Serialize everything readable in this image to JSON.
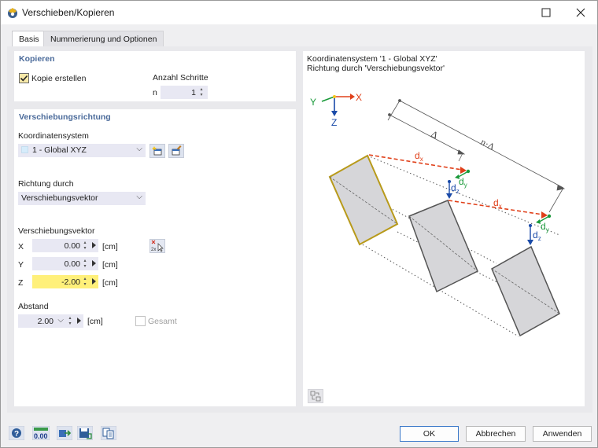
{
  "window": {
    "title": "Verschieben/Kopieren"
  },
  "tabs": [
    {
      "label": "Basis"
    },
    {
      "label": "Nummerierung und Optionen"
    }
  ],
  "kopieren": {
    "title": "Kopieren",
    "copy_label": "Kopie erstellen",
    "copy_checked": true,
    "steps_label": "Anzahl Schritte",
    "n_label": "n",
    "n_value": "1"
  },
  "verschiebung": {
    "title": "Verschiebungsrichtung",
    "coord_label": "Koordinatensystem",
    "coord_value": "1 - Global XYZ",
    "direction_label": "Richtung durch",
    "direction_value": "Verschiebungsvektor",
    "vector_label": "Verschiebungsvektor",
    "x_label": "X",
    "x_value": "0.00",
    "x_unit": "[cm]",
    "y_label": "Y",
    "y_value": "0.00",
    "y_unit": "[cm]",
    "z_label": "Z",
    "z_value": "-2.00",
    "z_unit": "[cm]",
    "distance_label": "Abstand",
    "distance_value": "2.00",
    "distance_unit": "[cm]",
    "total_label": "Gesamt",
    "pick_icon_text": "2x"
  },
  "preview": {
    "line1": "Koordinatensystem '1 - Global XYZ'",
    "line2": "Richtung durch 'Verschiebungsvektor'",
    "axis_x": "X",
    "axis_y": "Y",
    "axis_z": "Z",
    "delta": "Δ",
    "n_delta": "n·Δ",
    "dx": "d",
    "dx_sub": "x",
    "dy": "d",
    "dy_sub": "y",
    "dz": "d",
    "dz_sub": "z"
  },
  "buttons": {
    "ok": "OK",
    "cancel": "Abbrechen",
    "apply": "Anwenden"
  },
  "bottom_icons": {
    "units_text": "0.00"
  },
  "colors": {
    "highlight_field": "#fff07a",
    "accent_red": "#e0401a",
    "accent_green": "#1a9a3a",
    "accent_blue": "#1a4aa8",
    "selected_outline": "#b89a1a"
  }
}
